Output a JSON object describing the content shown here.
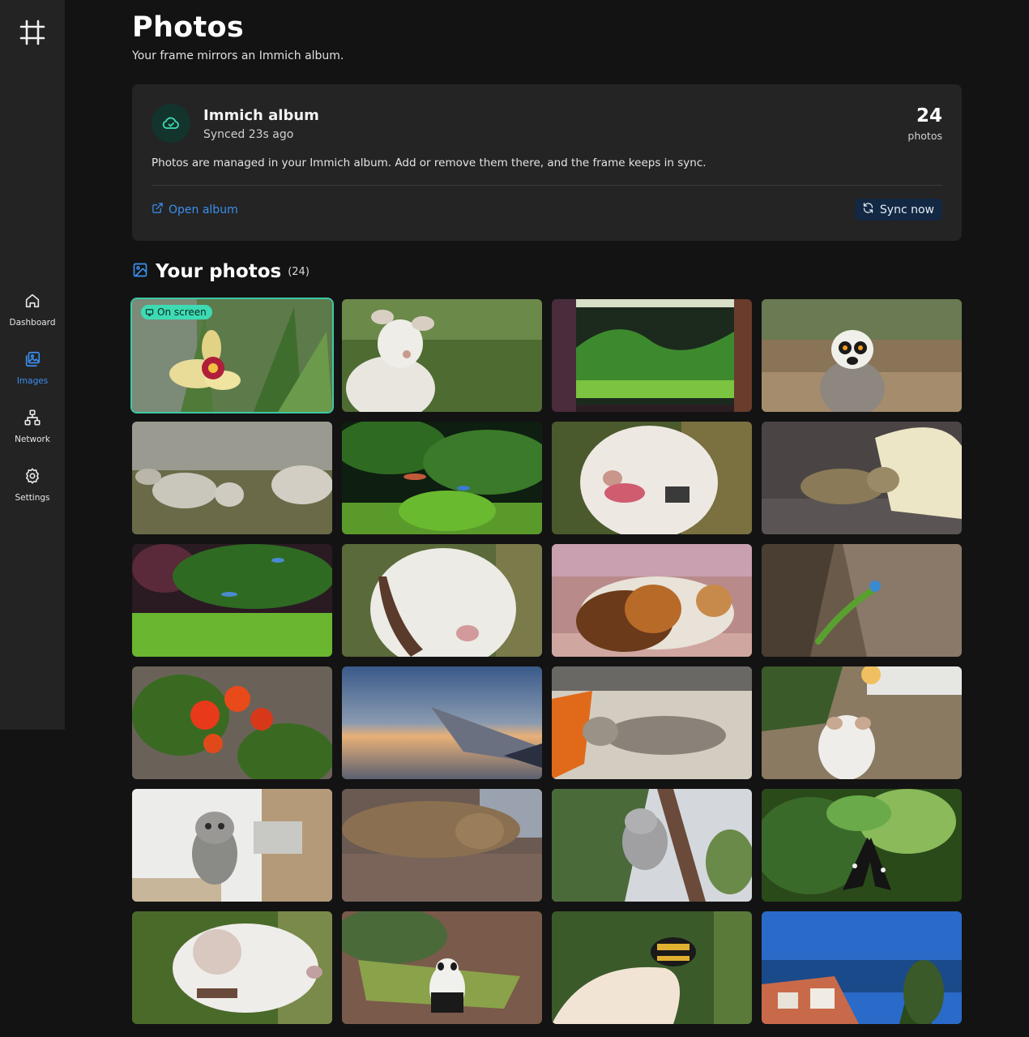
{
  "sidebar": {
    "logo_icon": "hash-frame-icon",
    "items": [
      {
        "label": "Dashboard",
        "icon": "home-icon",
        "active": false
      },
      {
        "label": "Images",
        "icon": "images-icon",
        "active": true
      },
      {
        "label": "Network",
        "icon": "network-icon",
        "active": false
      },
      {
        "label": "Settings",
        "icon": "gear-icon",
        "active": false
      }
    ]
  },
  "header": {
    "title": "Photos",
    "subtitle": "Your frame mirrors an Immich album."
  },
  "album_card": {
    "name": "Immich album",
    "synced": "Synced 23s ago",
    "count": "24",
    "count_label": "photos",
    "description": "Photos are managed in your Immich album. Add or remove them there, and the frame keeps in sync.",
    "open_label": "Open album",
    "sync_label": "Sync now"
  },
  "photos_section": {
    "title": "Your photos",
    "count": "(24)",
    "on_screen_label": "On screen"
  },
  "colors": {
    "accent": "#3b8ff0",
    "on_screen": "#3ddbb4"
  }
}
